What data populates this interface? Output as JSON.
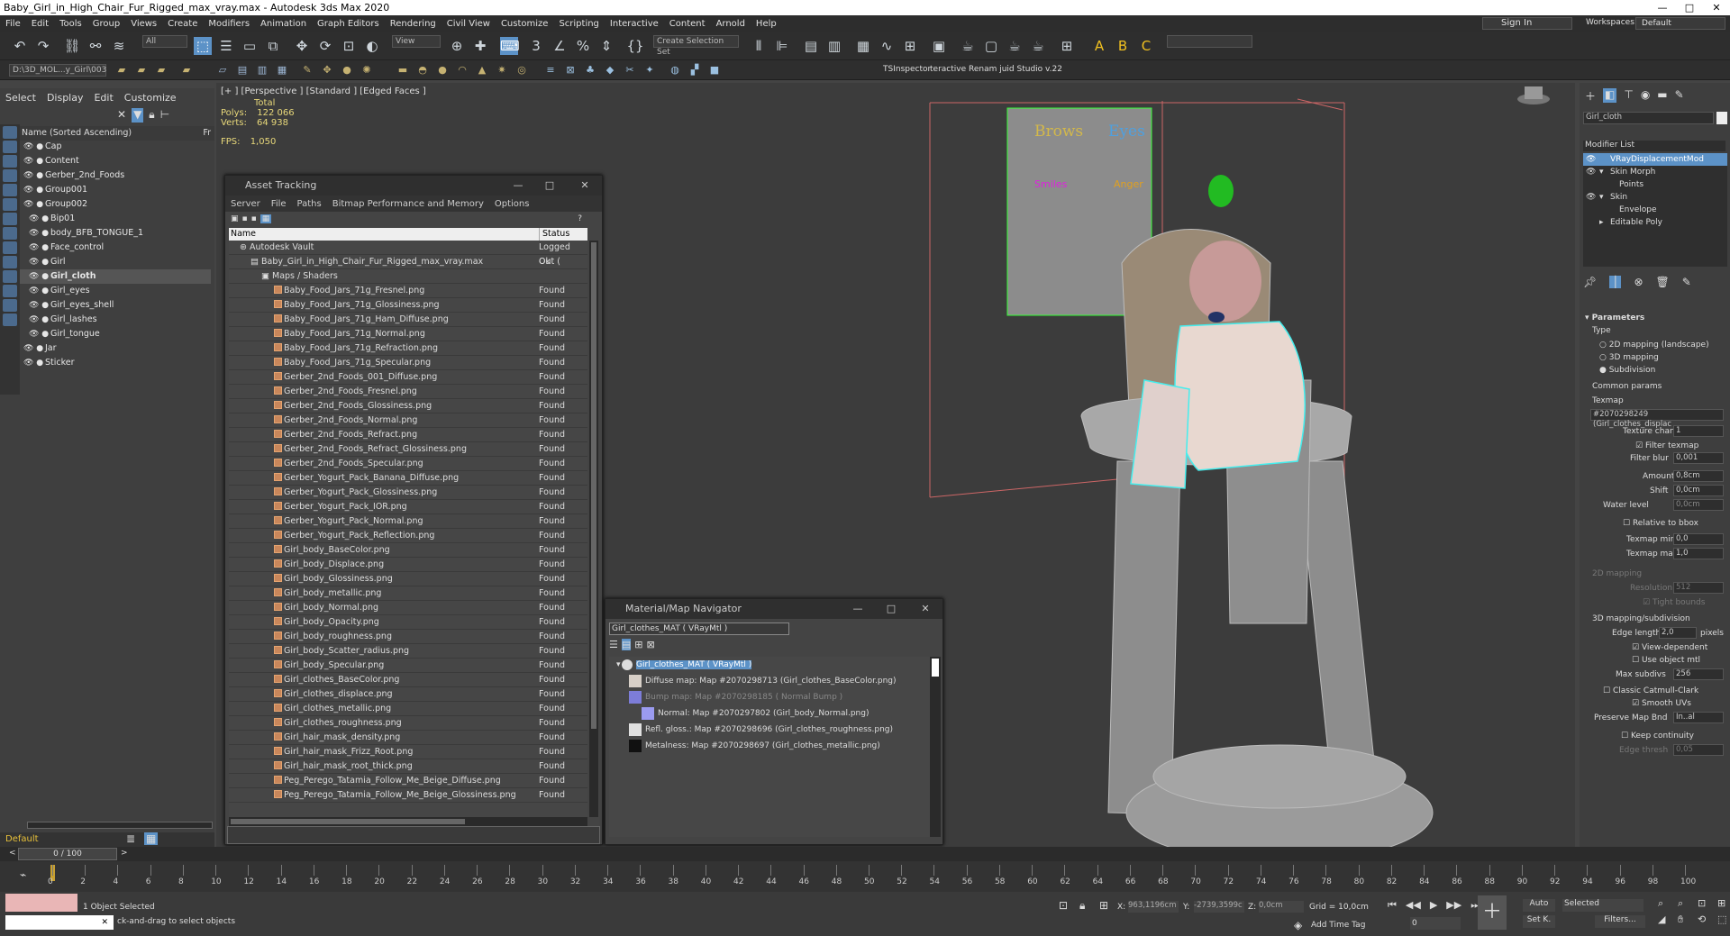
{
  "window": {
    "title": "Baby_Girl_in_High_Chair_Fur_Rigged_max_vray.max - Autodesk 3ds Max 2020",
    "min": "—",
    "max": "□",
    "close": "✕"
  },
  "menu": [
    "File",
    "Edit",
    "Tools",
    "Group",
    "Views",
    "Create",
    "Modifiers",
    "Animation",
    "Graph Editors",
    "Rendering",
    "Civil View",
    "Customize",
    "Scripting",
    "Interactive",
    "Content",
    "Arnold",
    "Help"
  ],
  "signin": {
    "label": "Sign In",
    "workspaces_label": "Workspaces:",
    "workspace": "Default"
  },
  "toolbar": {
    "selection_filter": "All",
    "view": "View",
    "selection_set": "Create Selection Set"
  },
  "toolbar2": {
    "path": "D:\\3D_MOL...y_Girl\\003",
    "tsinspector": "TSInspector",
    "renamer": "teractive Renam juid Studio v.22"
  },
  "scene": {
    "tabs": [
      "Select",
      "Display",
      "Edit",
      "Customize"
    ],
    "header": "Name (Sorted Ascending)",
    "header_right": "Fr",
    "items": [
      {
        "name": "Cap",
        "indent": 0
      },
      {
        "name": "Content",
        "indent": 0
      },
      {
        "name": "Gerber_2nd_Foods",
        "indent": 0
      },
      {
        "name": "Group001",
        "indent": 0
      },
      {
        "name": "Group002",
        "indent": 0
      },
      {
        "name": "Bip01",
        "indent": 1
      },
      {
        "name": "body_BFB_TONGUE_1",
        "indent": 1
      },
      {
        "name": "Face_control",
        "indent": 1
      },
      {
        "name": "Girl",
        "indent": 1
      },
      {
        "name": "Girl_cloth",
        "indent": 1,
        "sel": true
      },
      {
        "name": "Girl_eyes",
        "indent": 1
      },
      {
        "name": "Girl_eyes_shell",
        "indent": 1
      },
      {
        "name": "Girl_lashes",
        "indent": 1
      },
      {
        "name": "Girl_tongue",
        "indent": 1
      },
      {
        "name": "Jar",
        "indent": 0
      },
      {
        "name": "Sticker",
        "indent": 0
      }
    ],
    "layer": "Default"
  },
  "viewport": {
    "label": "[+ ] [Perspective ] [Standard ] [Edged Faces ]",
    "total": "Total",
    "polys_label": "Polys:",
    "polys": "122 066",
    "verts_label": "Verts:",
    "verts": "64 938",
    "fps_label": "FPS:",
    "fps": "1,050"
  },
  "board": {
    "brows": "Brows",
    "eyes": "Eyes",
    "smiles": "Smiles",
    "anger": "Anger"
  },
  "asset": {
    "title": "Asset Tracking",
    "menu": [
      "Server",
      "File",
      "Paths",
      "Bitmap Performance and Memory",
      "Options"
    ],
    "col_name": "Name",
    "col_status": "Status",
    "vault": "Autodesk Vault",
    "vault_status": "Logged Out (",
    "file": "Baby_Girl_in_High_Chair_Fur_Rigged_max_vray.max",
    "file_status": "Ok",
    "group": "Maps / Shaders",
    "found": "Found",
    "maps": [
      "Baby_Food_Jars_71g_Fresnel.png",
      "Baby_Food_Jars_71g_Glossiness.png",
      "Baby_Food_Jars_71g_Ham_Diffuse.png",
      "Baby_Food_Jars_71g_Normal.png",
      "Baby_Food_Jars_71g_Refraction.png",
      "Baby_Food_Jars_71g_Specular.png",
      "Gerber_2nd_Foods_001_Diffuse.png",
      "Gerber_2nd_Foods_Fresnel.png",
      "Gerber_2nd_Foods_Glossiness.png",
      "Gerber_2nd_Foods_Normal.png",
      "Gerber_2nd_Foods_Refract.png",
      "Gerber_2nd_Foods_Refract_Glossiness.png",
      "Gerber_2nd_Foods_Specular.png",
      "Gerber_Yogurt_Pack_Banana_Diffuse.png",
      "Gerber_Yogurt_Pack_Glossiness.png",
      "Gerber_Yogurt_Pack_IOR.png",
      "Gerber_Yogurt_Pack_Normal.png",
      "Gerber_Yogurt_Pack_Reflection.png",
      "Girl_body_BaseColor.png",
      "Girl_body_Displace.png",
      "Girl_body_Glossiness.png",
      "Girl_body_metallic.png",
      "Girl_body_Normal.png",
      "Girl_body_Opacity.png",
      "Girl_body_roughness.png",
      "Girl_body_Scatter_radius.png",
      "Girl_body_Specular.png",
      "Girl_clothes_BaseColor.png",
      "Girl_clothes_displace.png",
      "Girl_clothes_metallic.png",
      "Girl_clothes_roughness.png",
      "Girl_hair_mask_density.png",
      "Girl_hair_mask_Frizz_Root.png",
      "Girl_hair_mask_root_thick.png",
      "Peg_Perego_Tatamia_Follow_Me_Beige_Diffuse.png",
      "Peg_Perego_Tatamia_Follow_Me_Beige_Glossiness.png"
    ]
  },
  "matnav": {
    "title": "Material/Map Navigator",
    "field": "Girl_clothes_MAT  ( VRayMtl )",
    "root": "Girl_clothes_MAT  ( VRayMtl )",
    "rows": [
      {
        "text": "Diffuse map: Map #2070298713 (Girl_clothes_BaseColor.png)",
        "color": "#d8d0c8",
        "dim": false
      },
      {
        "text": "Bump map: Map #2070298185  ( Normal Bump )",
        "color": "#7d7dd8",
        "dim": true
      },
      {
        "text": "Normal: Map #2070297802 (Girl_body_Normal.png)",
        "color": "#9b9bf0",
        "dim": false
      },
      {
        "text": "Refl. gloss.: Map #2070298696 (Girl_clothes_roughness.png)",
        "color": "#e0e0e0",
        "dim": false
      },
      {
        "text": "Metalness: Map #2070298697 (Girl_clothes_metallic.png)",
        "color": "#111111",
        "dim": false
      }
    ]
  },
  "cmd": {
    "object": "Girl_cloth",
    "modlist_label": "Modifier List",
    "modifiers": [
      {
        "name": "VRayDisplacementMod",
        "eye": true,
        "arr": "",
        "sel": true,
        "indent": 0
      },
      {
        "name": "Skin Morph",
        "eye": true,
        "arr": "▾",
        "sel": false,
        "indent": 0
      },
      {
        "name": "Points",
        "eye": false,
        "arr": "",
        "sel": false,
        "indent": 1
      },
      {
        "name": "Skin",
        "eye": true,
        "arr": "▾",
        "sel": false,
        "indent": 0
      },
      {
        "name": "Envelope",
        "eye": false,
        "arr": "",
        "sel": false,
        "indent": 1
      },
      {
        "name": "Editable Poly",
        "eye": false,
        "arr": "▸",
        "sel": false,
        "indent": 0
      }
    ],
    "parameters": "Parameters",
    "type": "Type",
    "type_opts": [
      "2D mapping (landscape)",
      "3D mapping",
      "Subdivision"
    ],
    "common": "Common params",
    "texmap": "Texmap",
    "texmap_value": "#2070298249 (Girl_clothes_displac",
    "texture_chan": "Texture chan",
    "texture_chan_v": "1",
    "filter_texmap": "Filter texmap",
    "filter_blur": "Filter blur",
    "filter_blur_v": "0,001",
    "amount": "Amount",
    "amount_v": "0,8cm",
    "shift": "Shift",
    "shift_v": "0,0cm",
    "water": "Water level",
    "water_v": "0,0cm",
    "relative": "Relative to bbox",
    "texmap_min": "Texmap min",
    "texmap_min_v": "0,0",
    "texmap_max": "Texmap max",
    "texmap_max_v": "1,0",
    "mapping2d": "2D mapping",
    "resolution": "Resolution",
    "resolution_v": "512",
    "tight": "Tight bounds",
    "mapsub": "3D mapping/subdivision",
    "edge_length": "Edge length",
    "edge_length_v": "2,0",
    "pixels": "pixels",
    "view_dep": "View-dependent",
    "use_obj": "Use object mtl",
    "max_subdivs": "Max subdivs",
    "max_subdivs_v": "256",
    "classic": "Classic Catmull-Clark",
    "smooth": "Smooth UVs",
    "preserve": "Preserve Map Bnd",
    "preserve_v": "In..al",
    "keep": "Keep continuity",
    "edge_thresh": "Edge thresh",
    "edge_thresh_v": "0,05"
  },
  "timeline": {
    "slider": "0 / 100",
    "ticks": [
      "0",
      "2",
      "4",
      "6",
      "8",
      "10",
      "12",
      "14",
      "16",
      "18",
      "20",
      "22",
      "24",
      "26",
      "28",
      "30",
      "32",
      "34",
      "36",
      "38",
      "40",
      "42",
      "44",
      "46",
      "48",
      "50",
      "52",
      "54",
      "56",
      "58",
      "60",
      "62",
      "64",
      "66",
      "68",
      "70",
      "72",
      "74",
      "76",
      "78",
      "80",
      "82",
      "84",
      "86",
      "88",
      "90",
      "92",
      "94",
      "96",
      "98",
      "100"
    ]
  },
  "status": {
    "selected": "1 Object Selected",
    "hint": "ck-and-drag to select objects",
    "x_label": "X:",
    "x": "963,1196cm",
    "y_label": "Y:",
    "y": "-2739,3599c",
    "z_label": "Z:",
    "z": "0,0cm",
    "grid": "Grid = 10,0cm",
    "addtag": "Add Time Tag",
    "auto": "Auto",
    "setk": "Set K.",
    "selected_dd": "Selected",
    "filters": "Filters...",
    "frame": "0"
  }
}
